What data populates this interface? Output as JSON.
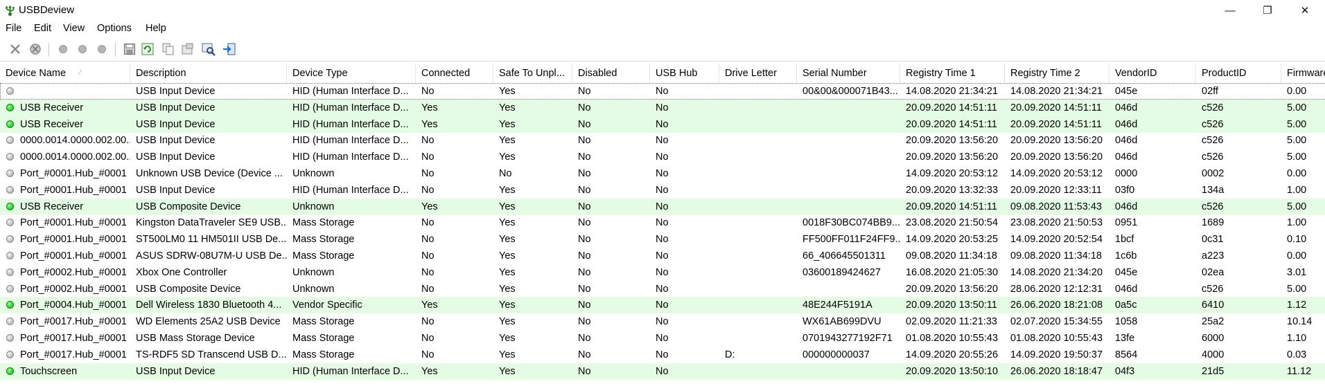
{
  "window": {
    "title": "USBDeview",
    "minimize_symbol": "—",
    "restore_symbol": "❐",
    "close_symbol": "✕"
  },
  "menu": [
    "File",
    "Edit",
    "View",
    "Options",
    "Help"
  ],
  "toolbar": {
    "icons": [
      "delete-icon",
      "uninstall-icon",
      "disable-icon",
      "enable-icon",
      "disconnect-icon",
      "save-icon",
      "refresh-icon",
      "copy-icon",
      "properties-icon",
      "find-icon",
      "exit-icon"
    ]
  },
  "table": {
    "columns": [
      "Device Name",
      "Description",
      "Device Type",
      "Connected",
      "Safe To Unpl...",
      "Disabled",
      "USB Hub",
      "Drive Letter",
      "Serial Number",
      "Registry Time 1",
      "Registry Time 2",
      "VendorID",
      "ProductID",
      "Firmware"
    ],
    "sort_indicator": "⁄",
    "rows": [
      {
        "status": "grey",
        "name": "",
        "desc": "USB Input Device",
        "type": "HID (Human Interface D...",
        "connected": "No",
        "safe": "Yes",
        "disabled": "No",
        "hub": "No",
        "drive": "",
        "serial": "00&00&000071B43...",
        "reg1": "14.08.2020 21:34:21",
        "reg2": "14.08.2020 21:34:21",
        "vendor": "045e",
        "product": "02ff",
        "firmware": "0.00"
      },
      {
        "status": "green",
        "name": "USB Receiver",
        "desc": "USB Input Device",
        "type": "HID (Human Interface D...",
        "connected": "Yes",
        "safe": "Yes",
        "disabled": "No",
        "hub": "No",
        "drive": "",
        "serial": "",
        "reg1": "20.09.2020 14:51:11",
        "reg2": "20.09.2020 14:51:11",
        "vendor": "046d",
        "product": "c526",
        "firmware": "5.00"
      },
      {
        "status": "green",
        "name": "USB Receiver",
        "desc": "USB Input Device",
        "type": "HID (Human Interface D...",
        "connected": "Yes",
        "safe": "Yes",
        "disabled": "No",
        "hub": "No",
        "drive": "",
        "serial": "",
        "reg1": "20.09.2020 14:51:11",
        "reg2": "20.09.2020 14:51:11",
        "vendor": "046d",
        "product": "c526",
        "firmware": "5.00"
      },
      {
        "status": "grey",
        "name": "0000.0014.0000.002.00...",
        "desc": "USB Input Device",
        "type": "HID (Human Interface D...",
        "connected": "No",
        "safe": "Yes",
        "disabled": "No",
        "hub": "No",
        "drive": "",
        "serial": "",
        "reg1": "20.09.2020 13:56:20",
        "reg2": "20.09.2020 13:56:20",
        "vendor": "046d",
        "product": "c526",
        "firmware": "5.00"
      },
      {
        "status": "grey",
        "name": "0000.0014.0000.002.00...",
        "desc": "USB Input Device",
        "type": "HID (Human Interface D...",
        "connected": "No",
        "safe": "Yes",
        "disabled": "No",
        "hub": "No",
        "drive": "",
        "serial": "",
        "reg1": "20.09.2020 13:56:20",
        "reg2": "20.09.2020 13:56:20",
        "vendor": "046d",
        "product": "c526",
        "firmware": "5.00"
      },
      {
        "status": "grey",
        "name": "Port_#0001.Hub_#0001",
        "desc": "Unknown USB Device (Device ...",
        "type": "Unknown",
        "connected": "No",
        "safe": "No",
        "disabled": "No",
        "hub": "No",
        "drive": "",
        "serial": "",
        "reg1": "14.09.2020 20:53:12",
        "reg2": "14.09.2020 20:53:12",
        "vendor": "0000",
        "product": "0002",
        "firmware": "0.00"
      },
      {
        "status": "grey",
        "name": "Port_#0001.Hub_#0001",
        "desc": "USB Input Device",
        "type": "HID (Human Interface D...",
        "connected": "No",
        "safe": "Yes",
        "disabled": "No",
        "hub": "No",
        "drive": "",
        "serial": "",
        "reg1": "20.09.2020 13:32:33",
        "reg2": "20.09.2020 12:33:11",
        "vendor": "03f0",
        "product": "134a",
        "firmware": "1.00"
      },
      {
        "status": "green",
        "name": "USB Receiver",
        "desc": "USB Composite Device",
        "type": "Unknown",
        "connected": "Yes",
        "safe": "Yes",
        "disabled": "No",
        "hub": "No",
        "drive": "",
        "serial": "",
        "reg1": "20.09.2020 14:51:11",
        "reg2": "09.08.2020 11:53:43",
        "vendor": "046d",
        "product": "c526",
        "firmware": "5.00"
      },
      {
        "status": "grey",
        "name": "Port_#0001.Hub_#0001",
        "desc": "Kingston DataTraveler SE9 USB...",
        "type": "Mass Storage",
        "connected": "No",
        "safe": "Yes",
        "disabled": "No",
        "hub": "No",
        "drive": "",
        "serial": "0018F30BC074BB9...",
        "reg1": "23.08.2020 21:50:54",
        "reg2": "23.08.2020 21:50:53",
        "vendor": "0951",
        "product": "1689",
        "firmware": "1.00"
      },
      {
        "status": "grey",
        "name": "Port_#0001.Hub_#0001",
        "desc": "ST500LM0 11 HM501II USB De...",
        "type": "Mass Storage",
        "connected": "No",
        "safe": "Yes",
        "disabled": "No",
        "hub": "No",
        "drive": "",
        "serial": "FF500FF011F24FF9...",
        "reg1": "14.09.2020 20:53:25",
        "reg2": "14.09.2020 20:52:54",
        "vendor": "1bcf",
        "product": "0c31",
        "firmware": "0.10"
      },
      {
        "status": "grey",
        "name": "Port_#0001.Hub_#0001",
        "desc": "ASUS SDRW-08U7M-U USB De...",
        "type": "Mass Storage",
        "connected": "No",
        "safe": "Yes",
        "disabled": "No",
        "hub": "No",
        "drive": "",
        "serial": "66_406645501311",
        "reg1": "09.08.2020 11:34:18",
        "reg2": "09.08.2020 11:34:18",
        "vendor": "1c6b",
        "product": "a223",
        "firmware": "0.00"
      },
      {
        "status": "grey",
        "name": "Port_#0002.Hub_#0001",
        "desc": "Xbox One Controller",
        "type": "Unknown",
        "connected": "No",
        "safe": "Yes",
        "disabled": "No",
        "hub": "No",
        "drive": "",
        "serial": "03600189424627",
        "reg1": "16.08.2020 21:05:30",
        "reg2": "14.08.2020 21:34:20",
        "vendor": "045e",
        "product": "02ea",
        "firmware": "3.01"
      },
      {
        "status": "grey",
        "name": "Port_#0002.Hub_#0001",
        "desc": "USB Composite Device",
        "type": "Unknown",
        "connected": "No",
        "safe": "Yes",
        "disabled": "No",
        "hub": "No",
        "drive": "",
        "serial": "",
        "reg1": "20.09.2020 13:56:20",
        "reg2": "28.06.2020 12:12:31",
        "vendor": "046d",
        "product": "c526",
        "firmware": "5.00"
      },
      {
        "status": "green",
        "name": "Port_#0004.Hub_#0001",
        "desc": "Dell Wireless 1830 Bluetooth 4...",
        "type": "Vendor Specific",
        "connected": "Yes",
        "safe": "Yes",
        "disabled": "No",
        "hub": "No",
        "drive": "",
        "serial": "48E244F5191A",
        "reg1": "20.09.2020 13:50:11",
        "reg2": "26.06.2020 18:21:08",
        "vendor": "0a5c",
        "product": "6410",
        "firmware": "1.12"
      },
      {
        "status": "grey",
        "name": "Port_#0017.Hub_#0001",
        "desc": "WD Elements 25A2 USB Device",
        "type": "Mass Storage",
        "connected": "No",
        "safe": "Yes",
        "disabled": "No",
        "hub": "No",
        "drive": "",
        "serial": "WX61AB699DVU",
        "reg1": "02.09.2020 11:21:33",
        "reg2": "02.07.2020 15:34:55",
        "vendor": "1058",
        "product": "25a2",
        "firmware": "10.14"
      },
      {
        "status": "grey",
        "name": "Port_#0017.Hub_#0001",
        "desc": "USB Mass Storage Device",
        "type": "Mass Storage",
        "connected": "No",
        "safe": "Yes",
        "disabled": "No",
        "hub": "No",
        "drive": "",
        "serial": "0701943277192F71",
        "reg1": "01.08.2020 10:55:43",
        "reg2": "01.08.2020 10:55:43",
        "vendor": "13fe",
        "product": "6000",
        "firmware": "1.10"
      },
      {
        "status": "grey",
        "name": "Port_#0017.Hub_#0001",
        "desc": "TS-RDF5 SD  Transcend USB D...",
        "type": "Mass Storage",
        "connected": "No",
        "safe": "Yes",
        "disabled": "No",
        "hub": "No",
        "drive": "D:",
        "serial": "000000000037",
        "reg1": "14.09.2020 20:55:26",
        "reg2": "14.09.2020 19:50:37",
        "vendor": "8564",
        "product": "4000",
        "firmware": "0.03"
      },
      {
        "status": "green",
        "name": "Touchscreen",
        "desc": "USB Input Device",
        "type": "HID (Human Interface D...",
        "connected": "Yes",
        "safe": "Yes",
        "disabled": "No",
        "hub": "No",
        "drive": "",
        "serial": "",
        "reg1": "20.09.2020 13:50:10",
        "reg2": "26.06.2020 18:18:47",
        "vendor": "04f3",
        "product": "21d5",
        "firmware": "11.12"
      }
    ]
  }
}
